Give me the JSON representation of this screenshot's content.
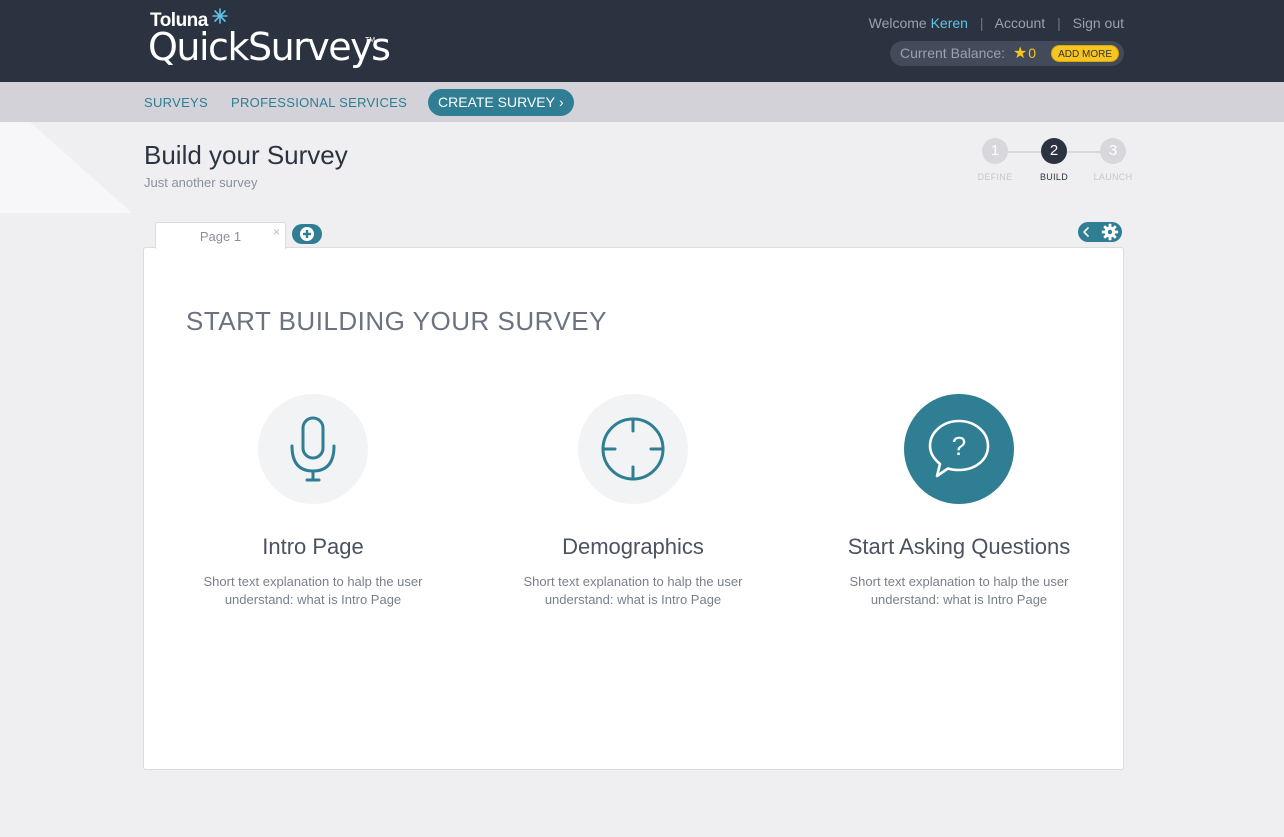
{
  "header": {
    "logo_top": "Toluna",
    "logo_main": "QuickSurveys",
    "logo_tm": "TM",
    "welcome": "Welcome",
    "user_name": "Keren",
    "account": "Account",
    "signout": "Sign out",
    "sep": "|",
    "balance_label": "Current Balance:",
    "balance_star": "★",
    "balance_value": "0",
    "add_more": "ADD MORE"
  },
  "nav": {
    "surveys": "SURVEYS",
    "professional": "PROFESSIONAL SERVICES",
    "create": "CREATE SURVEY",
    "create_chevron": "›"
  },
  "page": {
    "title": "Build your Survey",
    "subtitle": "Just another survey"
  },
  "steps": [
    {
      "num": "1",
      "label": "DEFINE"
    },
    {
      "num": "2",
      "label": "BUILD"
    },
    {
      "num": "3",
      "label": "LAUNCH"
    }
  ],
  "tabs": {
    "page1": "Page 1",
    "close": "×"
  },
  "panel": {
    "title": "START BUILDING YOUR SURVEY",
    "cards": [
      {
        "title": "Intro Page",
        "desc": "Short text explanation to halp the user understand: what is Intro Page",
        "icon": "microphone-icon"
      },
      {
        "title": "Demographics",
        "desc": "Short text explanation to halp the user understand: what is Intro Page",
        "icon": "crosshair-icon"
      },
      {
        "title": "Start Asking Questions",
        "desc": "Short text explanation to halp the user understand: what is Intro Page",
        "icon": "question-bubble-icon"
      }
    ]
  },
  "colors": {
    "header_bg": "#2c3340",
    "nav_bg": "#d3d2d9",
    "accent": "#2f7e93",
    "highlight": "#5ec3e6",
    "gold": "#f7c51e"
  }
}
